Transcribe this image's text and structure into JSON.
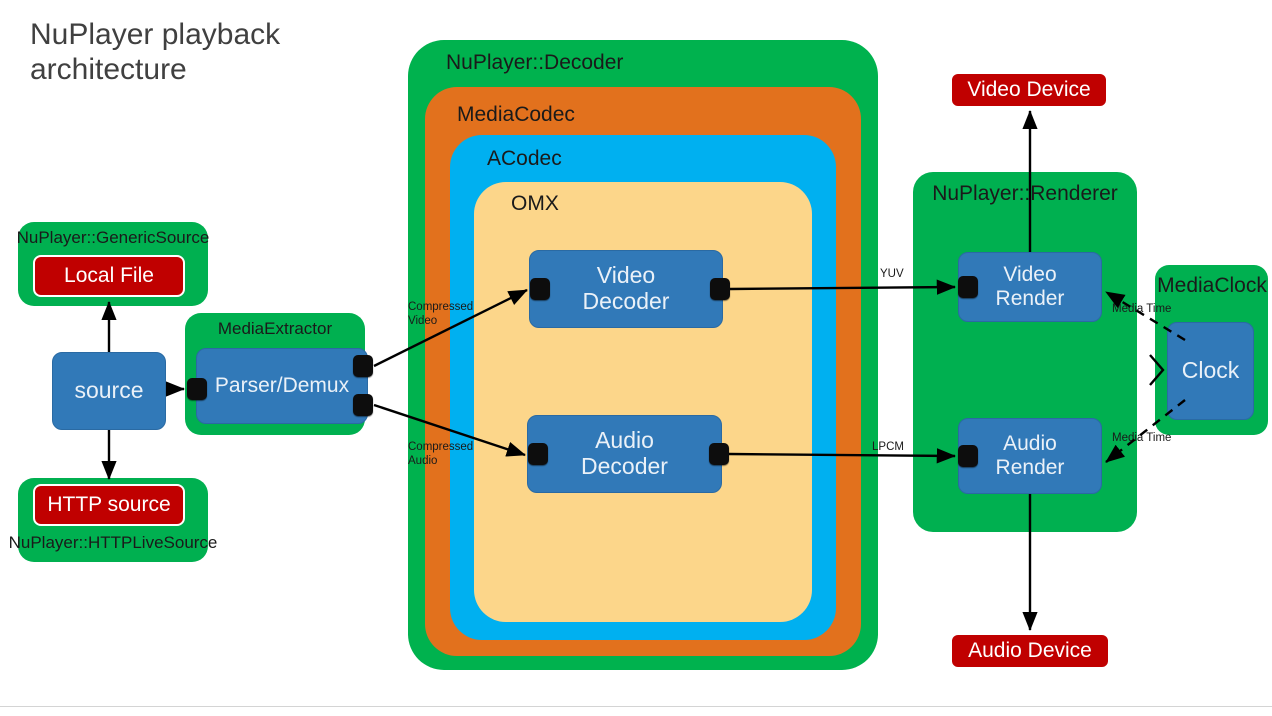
{
  "title": "NuPlayer playback\narchitecture",
  "colors": {
    "green": "#00B050",
    "orange": "#E2711D",
    "cyan": "#00B0F0",
    "peach": "#FCD68A",
    "blue": "#3179B8",
    "red": "#C00000",
    "wire": "#000000",
    "title_text": "#404040"
  },
  "source_section": {
    "generic_source_label": "NuPlayer::GenericSource",
    "local_file_label": "Local File",
    "source_label": "source",
    "http_source_label": "HTTP source",
    "http_live_source_label": "NuPlayer::HTTPLiveSource"
  },
  "extractor_section": {
    "container_label": "MediaExtractor",
    "parser_label": "Parser/Demux"
  },
  "decoder_section": {
    "layers": [
      {
        "name": "NuPlayer::Decoder",
        "color": "#00B050"
      },
      {
        "name": "MediaCodec",
        "color": "#E2711D"
      },
      {
        "name": "ACodec",
        "color": "#00B0F0"
      },
      {
        "name": "OMX",
        "color": "#FCD68A"
      }
    ],
    "video_decoder_label": "Video\nDecoder",
    "audio_decoder_label": "Audio\nDecoder"
  },
  "renderer_section": {
    "container_label": "NuPlayer::Renderer",
    "video_render_label": "Video\nRender",
    "audio_render_label": "Audio\nRender",
    "video_device_label": "Video Device",
    "audio_device_label": "Audio Device"
  },
  "clock_section": {
    "container_label": "MediaClock",
    "clock_label": "Clock"
  },
  "edge_labels": {
    "compressed_video": "Compressed\nVideo",
    "compressed_audio": "Compressed\nAudio",
    "yuv": "YUV",
    "lpcm": "LPCM",
    "media_time_video": "Media Time",
    "media_time_audio": "Media Time"
  }
}
